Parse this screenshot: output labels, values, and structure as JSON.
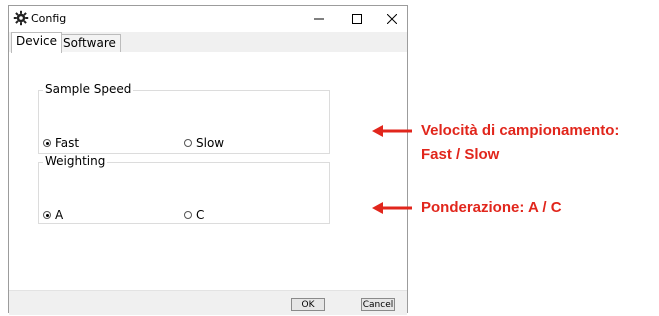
{
  "window": {
    "title": "Config",
    "controls": {
      "minimize": "–",
      "maximize": "☐",
      "close": "✕"
    }
  },
  "tabs": [
    {
      "label": "Device",
      "active": true
    },
    {
      "label": "Software",
      "active": false
    }
  ],
  "groups": {
    "sample_speed": {
      "title": "Sample Speed",
      "options": [
        {
          "label": "Fast",
          "selected": true
        },
        {
          "label": "Slow",
          "selected": false
        }
      ]
    },
    "weighting": {
      "title": "Weighting",
      "options": [
        {
          "label": "A",
          "selected": true
        },
        {
          "label": "C",
          "selected": false
        }
      ]
    }
  },
  "buttons": {
    "ok": "OK",
    "cancel": "Cancel"
  },
  "annotations": [
    {
      "line1": "Velocità di campionamento:",
      "line2": "Fast / Slow"
    },
    {
      "line1": "Ponderazione: A / C"
    }
  ],
  "colors": {
    "annotation": "#e1261c"
  },
  "icons": {
    "app": "gear-icon",
    "arrow": "arrow-left-icon"
  }
}
